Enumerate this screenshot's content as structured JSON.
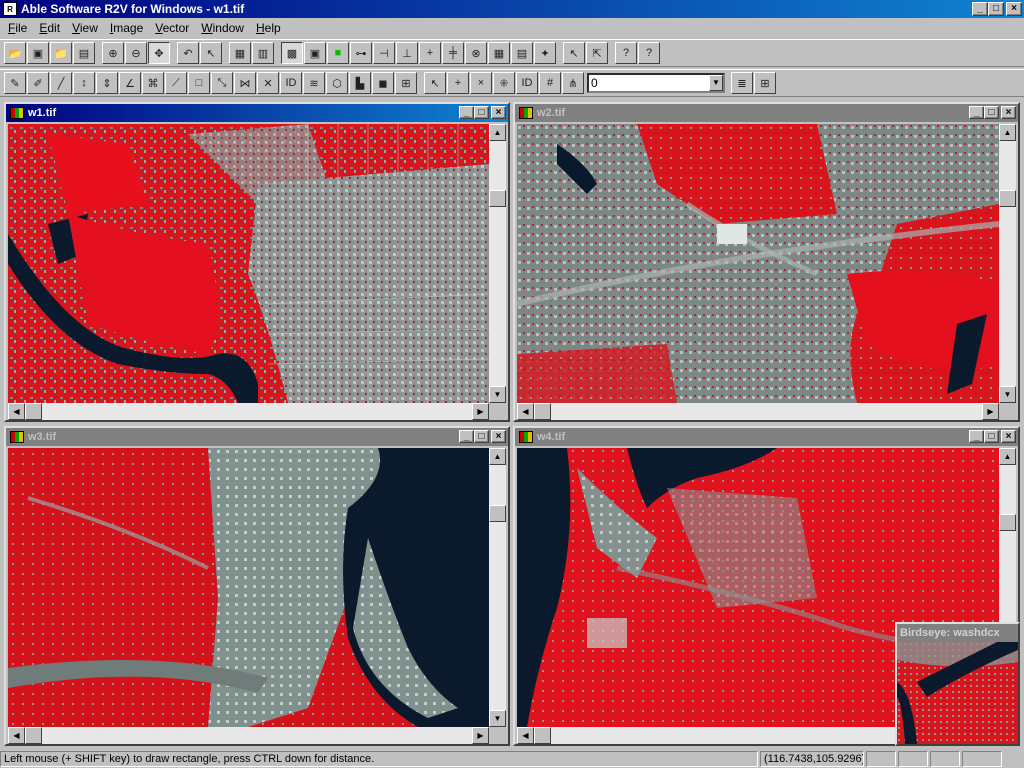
{
  "app": {
    "title": "Able Software R2V for Windows - w1.tif",
    "icon_name": "r2v-app-icon"
  },
  "caption_buttons": {
    "minimize": "_",
    "maximize": "□",
    "close": "×"
  },
  "menu": [
    "File",
    "Edit",
    "View",
    "Image",
    "Vector",
    "Window",
    "Help"
  ],
  "toolbar1": [
    {
      "name": "open-icon",
      "glyph": "📂"
    },
    {
      "name": "save-icon",
      "glyph": "▣"
    },
    {
      "name": "open-folder-icon",
      "glyph": "📁"
    },
    {
      "name": "print-icon",
      "glyph": "▤"
    },
    {
      "sep": true
    },
    {
      "name": "zoom-in-icon",
      "glyph": "⊕"
    },
    {
      "name": "zoom-out-icon",
      "glyph": "⊖"
    },
    {
      "name": "pan-icon",
      "glyph": "✥",
      "pressed": true
    },
    {
      "sep": true
    },
    {
      "name": "undo-icon",
      "glyph": "↶"
    },
    {
      "name": "select-arrow-icon",
      "glyph": "↖"
    },
    {
      "sep": true
    },
    {
      "name": "image-properties-icon",
      "glyph": "▦"
    },
    {
      "name": "layer-icon",
      "glyph": "▥"
    },
    {
      "sep": true
    },
    {
      "name": "image-display-icon",
      "glyph": "▩",
      "pressed": true
    },
    {
      "name": "fit-window-icon",
      "glyph": "▣"
    },
    {
      "name": "green-square-icon",
      "glyph": "■",
      "color": "#00c000"
    },
    {
      "name": "node-line-icon",
      "glyph": "⊶"
    },
    {
      "name": "line-split-icon",
      "glyph": "⊣"
    },
    {
      "name": "vertex-icon",
      "glyph": "⊥"
    },
    {
      "name": "cross-icon",
      "glyph": "+"
    },
    {
      "name": "cross-vertical-icon",
      "glyph": "╪"
    },
    {
      "name": "circle-x-icon",
      "glyph": "⊗"
    },
    {
      "name": "grid-icon",
      "glyph": "▦"
    },
    {
      "name": "label-grid-icon",
      "glyph": "▤"
    },
    {
      "name": "star-icon",
      "glyph": "✦"
    },
    {
      "sep": true
    },
    {
      "name": "pointer-stop-icon",
      "glyph": "↖"
    },
    {
      "name": "pointer-edit-icon",
      "glyph": "⇱"
    },
    {
      "sep": true
    },
    {
      "name": "help-icon",
      "glyph": "?"
    },
    {
      "name": "context-help-icon",
      "glyph": "?"
    }
  ],
  "toolbar2": [
    {
      "name": "digitize-icon",
      "glyph": "✎"
    },
    {
      "name": "pen-icon",
      "glyph": "✐"
    },
    {
      "name": "line-draw-icon",
      "glyph": "╱"
    },
    {
      "name": "vertical-split-icon",
      "glyph": "↕"
    },
    {
      "name": "merge-icon",
      "glyph": "⇕"
    },
    {
      "name": "angle-icon",
      "glyph": "∠"
    },
    {
      "name": "node-snap-icon",
      "glyph": "⌘"
    },
    {
      "name": "line-extend-icon",
      "glyph": "⟋"
    },
    {
      "name": "rectangle-icon",
      "glyph": "□"
    },
    {
      "name": "diagonal-icon",
      "glyph": "⤡"
    },
    {
      "name": "join-icon",
      "glyph": "⋈"
    },
    {
      "name": "delete-x-icon",
      "glyph": "✕"
    },
    {
      "name": "id-label-icon",
      "glyph": "ID"
    },
    {
      "name": "contour-icon",
      "glyph": "≋"
    },
    {
      "name": "polygon-icon",
      "glyph": "⬡"
    },
    {
      "name": "fill-icon",
      "glyph": "▙"
    },
    {
      "name": "area-icon",
      "glyph": "◼"
    },
    {
      "name": "raster-icon",
      "glyph": "⊞"
    },
    {
      "sep": true
    },
    {
      "name": "select-node-icon",
      "glyph": "↖"
    },
    {
      "name": "add-node-icon",
      "glyph": "+"
    },
    {
      "name": "remove-node-icon",
      "glyph": "×"
    },
    {
      "name": "move-node-icon",
      "glyph": "⁜"
    },
    {
      "name": "node-id-icon",
      "glyph": "ID"
    },
    {
      "name": "node-number-icon",
      "glyph": "#"
    },
    {
      "name": "node-tree-icon",
      "glyph": "⋔"
    }
  ],
  "attribute_combo": {
    "value": "0"
  },
  "toolbar2_tail": [
    {
      "name": "list-lines-icon",
      "glyph": "≣"
    },
    {
      "name": "table-icon",
      "glyph": "⊞"
    }
  ],
  "windows": [
    {
      "id": "w1",
      "title": "w1.tif",
      "active": true
    },
    {
      "id": "w2",
      "title": "w2.tif",
      "active": false
    },
    {
      "id": "w3",
      "title": "w3.tif",
      "active": false
    },
    {
      "id": "w4",
      "title": "w4.tif",
      "active": false
    }
  ],
  "birdseye": {
    "title": "Birdseye: washdcx"
  },
  "status": {
    "message": "Left mouse (+ SHIFT key) to draw rectangle, press CTRL down for distance.",
    "coords": "(116.7438,105.9296)"
  },
  "colors": {
    "vegetation": "#e0141e",
    "urban": "#7a8a88",
    "water": "#0a1420",
    "title_active": "#000080"
  }
}
